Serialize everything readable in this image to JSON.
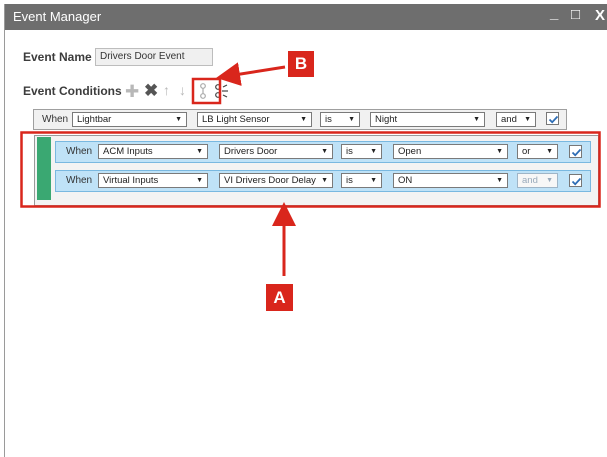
{
  "window": {
    "title": "Event Manager",
    "minimize_icon": "_",
    "maximize_icon": "□",
    "close_icon": "X"
  },
  "event_name": {
    "label": "Event Name",
    "value": "Drivers Door Event"
  },
  "conditions": {
    "label": "Event Conditions",
    "tool_icons": [
      "add-icon",
      "delete-icon",
      "move-up-icon",
      "move-down-icon",
      "group-icon",
      "ungroup-icon"
    ],
    "rows": [
      {
        "when": "When",
        "source": "Lightbar",
        "input": "LB Light Sensor",
        "op": "is",
        "value": "Night",
        "conj": "and",
        "checked": true
      },
      {
        "when": "When",
        "source": "ACM Inputs",
        "input": "Drivers Door",
        "op": "is",
        "value": "Open",
        "conj": "or",
        "checked": true
      },
      {
        "when": "When",
        "source": "Virtual Inputs",
        "input": "VI Drivers Door Delay",
        "op": "is",
        "value": "ON",
        "conj": "and",
        "checked": true
      }
    ]
  },
  "annotations": {
    "a_label": "A",
    "b_label": "B",
    "color": "#d9261c"
  }
}
